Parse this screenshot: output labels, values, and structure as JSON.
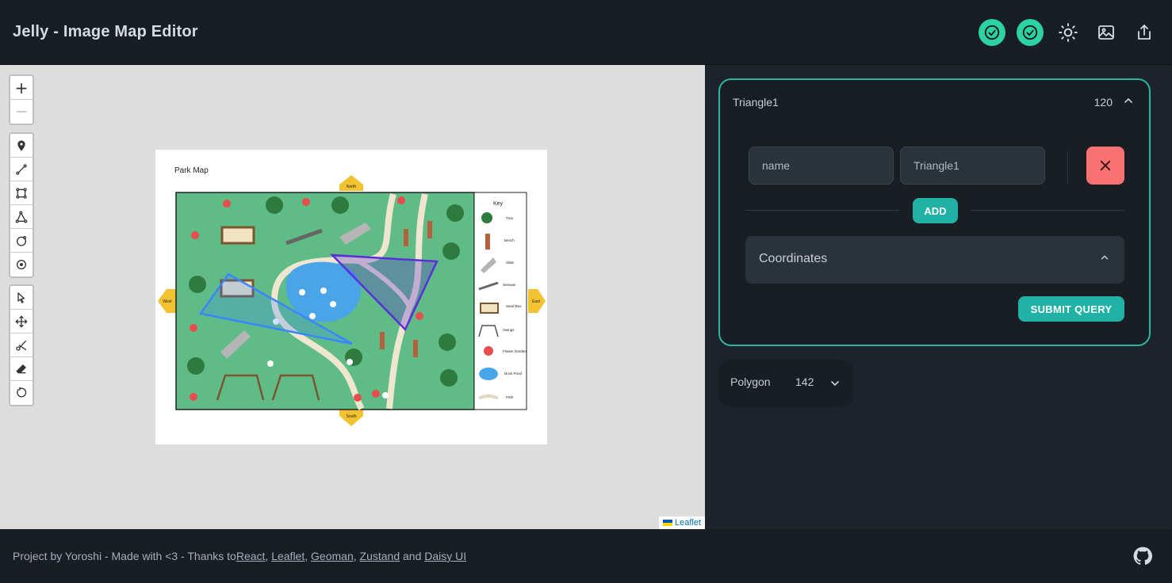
{
  "header": {
    "title": "Jelly - Image Map Editor",
    "icons": [
      "check-circle-icon",
      "check-circle-icon",
      "sun-icon",
      "image-icon",
      "upload-icon"
    ]
  },
  "colors": {
    "accent": "#1fb2a5",
    "status": "#2cd3a0",
    "danger": "#f87272",
    "triangle1": "#3a86ff",
    "polygon": "#5a2fd8"
  },
  "map": {
    "attribution": "Leaflet",
    "image": {
      "title": "Park Map",
      "compass": {
        "north": "North",
        "south": "South",
        "east": "East",
        "west": "West"
      },
      "key": {
        "title": "Key",
        "items": [
          "Tree",
          "Bench",
          "Slide",
          "Seesaw",
          "Sand Box",
          "Swings",
          "Flower Garden",
          "Duck Pond",
          "Path"
        ]
      }
    },
    "toolbar": {
      "zoom_in": "+",
      "zoom_out": "—"
    }
  },
  "shapes": [
    {
      "title": "Triangle1",
      "count": "120",
      "field_key": "name",
      "field_value": "Triangle1",
      "add_label": "ADD",
      "coordinates_label": "Coordinates",
      "submit_label": "SUBMIT QUERY"
    },
    {
      "title": "Polygon",
      "count": "142"
    }
  ],
  "footer": {
    "prefix": "Project by Yoroshi - Made with <3 - Thanks to ",
    "links": [
      "React",
      "Leaflet",
      "Geoman",
      "Zustand",
      "Daisy UI"
    ],
    "and_text": " and "
  }
}
